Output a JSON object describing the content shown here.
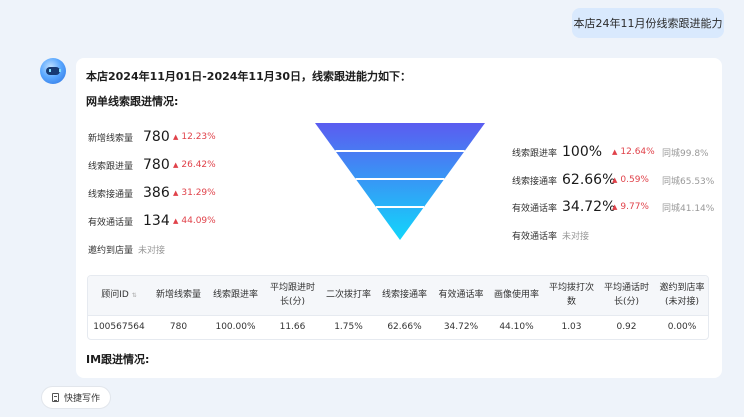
{
  "user_message": "本店24年11月份线索跟进能力",
  "reply": {
    "intro": "本店2024年11月01日-2024年11月30日，线索跟进能力如下：",
    "online_section_title": "网单线索跟进情况:",
    "im_section_title": "IM跟进情况:"
  },
  "left_metrics": [
    {
      "label": "新增线索量",
      "value": "780",
      "delta": "12.23%"
    },
    {
      "label": "线索跟进量",
      "value": "780",
      "delta": "26.42%"
    },
    {
      "label": "线索接通量",
      "value": "386",
      "delta": "31.29%"
    },
    {
      "label": "有效通话量",
      "value": "134",
      "delta": "44.09%"
    },
    {
      "label": "邀约到店量",
      "value": "",
      "delta": "",
      "extra": "未对接"
    }
  ],
  "right_metrics": [
    {
      "label": "线索跟进率",
      "value": "100%",
      "delta": "12.64%",
      "extra": "同城99.8%"
    },
    {
      "label": "线索接通率",
      "value": "62.66%",
      "delta": "0.59%",
      "extra": "同城65.53%"
    },
    {
      "label": "有效通话率",
      "value": "34.72%",
      "delta": "9.77%",
      "extra": "同城41.14%"
    },
    {
      "label": "有效通话率",
      "value": "",
      "delta": "",
      "extra": "未对接"
    }
  ],
  "funnel_colors": [
    "#5b5cf0",
    "#12d6fb"
  ],
  "delta_color": "#e0424a",
  "table": {
    "headers": [
      "顾问ID",
      "新增线索量",
      "线索跟进率",
      "平均跟进时长(分)",
      "二次拨打率",
      "线索接通率",
      "有效通话率",
      "画像使用率",
      "平均拨打次数",
      "平均通话时长(分)",
      "邀约到店率(未对接)"
    ],
    "sort_icon": "sort-arrows-icon",
    "rows": [
      [
        "100567564",
        "780",
        "100.00%",
        "11.66",
        "1.75%",
        "62.66%",
        "34.72%",
        "44.10%",
        "1.03",
        "0.92",
        "0.00%"
      ]
    ]
  },
  "quick_write": {
    "label": "快捷写作",
    "icon": "document-icon"
  }
}
